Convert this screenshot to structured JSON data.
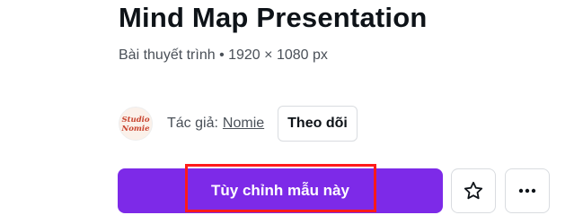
{
  "template": {
    "title": "Mind Map Presentation",
    "subtitle": "Bài thuyết trình • 1920 × 1080 px"
  },
  "author": {
    "prefix": "Tác giả:",
    "name": "Nomie",
    "avatar_text_line1": "Studio",
    "avatar_text_line2": "Nomie",
    "follow_label": "Theo dõi"
  },
  "actions": {
    "customize_label": "Tùy chỉnh mẫu này",
    "favorite_icon": "star-icon",
    "more_icon": "more-horizontal-icon"
  },
  "colors": {
    "primary": "#7d2ae8",
    "highlight": "#ff1a1a",
    "avatar_ink": "#c8432e"
  }
}
